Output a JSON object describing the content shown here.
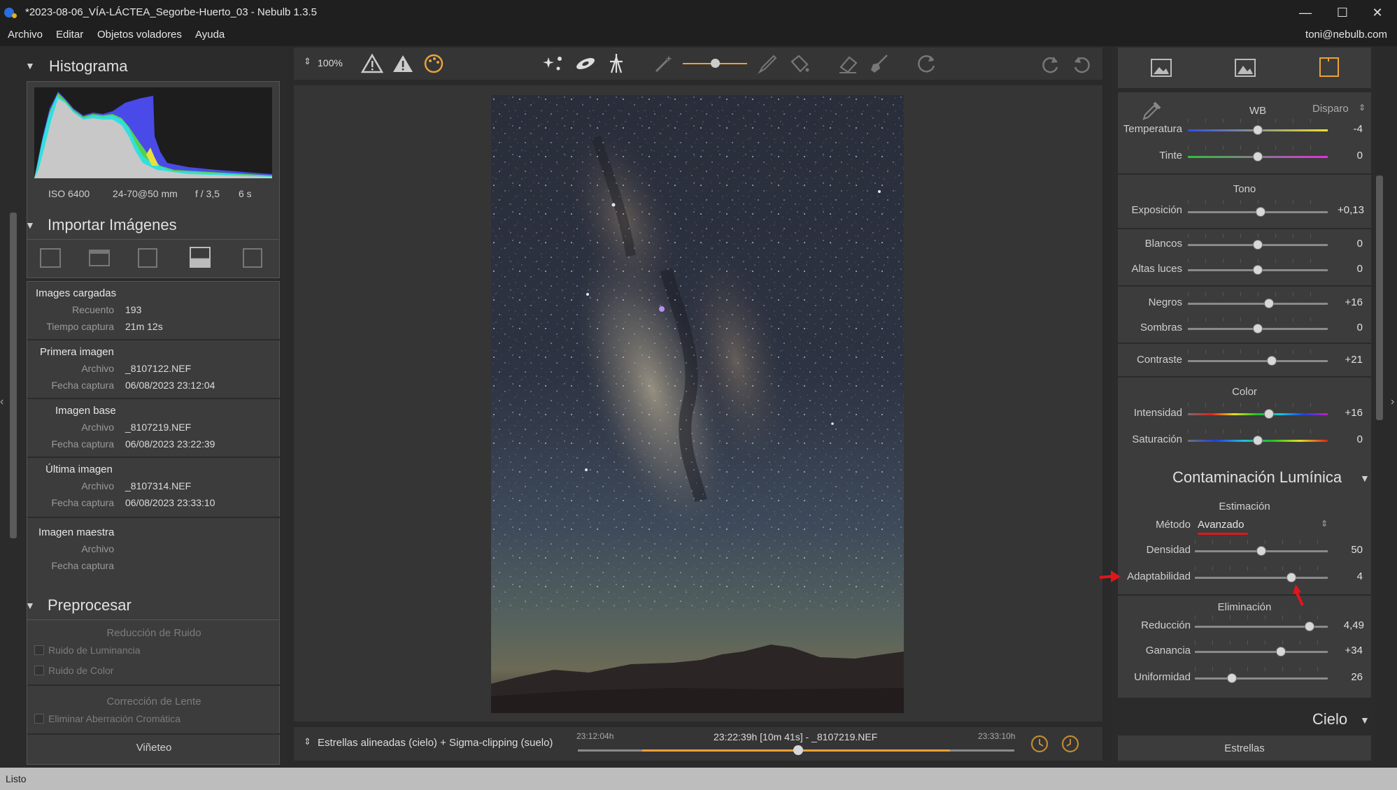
{
  "window": {
    "title": "*2023-08-06_VÍA-LÁCTEA_Segorbe-Huerto_03 - Nebulb 1.3.5",
    "min": "—",
    "max": "☐",
    "close": "✕"
  },
  "menu": {
    "items": [
      "Archivo",
      "Editar",
      "Objetos voladores",
      "Ayuda"
    ],
    "user": "toni@nebulb.com"
  },
  "histogram": {
    "title": "Histograma",
    "iso": "ISO 6400",
    "lens": "24-70@50 mm",
    "aperture": "f / 3,5",
    "exposure": "6 s"
  },
  "import": {
    "title": "Importar Imágenes",
    "loaded": {
      "header": "Images cargadas",
      "count_label": "Recuento",
      "count": "193",
      "time_label": "Tiempo captura",
      "time": "21m 12s"
    },
    "first": {
      "header": "Primera imagen",
      "file_label": "Archivo",
      "file": "_8107122.NEF",
      "date_label": "Fecha captura",
      "date": "06/08/2023 23:12:04"
    },
    "base": {
      "header": "Imagen base",
      "file_label": "Archivo",
      "file": "_8107219.NEF",
      "date_label": "Fecha captura",
      "date": "06/08/2023 23:22:39"
    },
    "last": {
      "header": "Última imagen",
      "file_label": "Archivo",
      "file": "_8107314.NEF",
      "date_label": "Fecha captura",
      "date": "06/08/2023 23:33:10"
    },
    "master": {
      "header": "Imagen maestra",
      "file_label": "Archivo",
      "date_label": "Fecha captura"
    }
  },
  "preprocess": {
    "title": "Preprocesar",
    "noise_header": "Reducción de Ruido",
    "noise_lum": "Ruido de Luminancia",
    "noise_color": "Ruido de Color",
    "lens_header": "Corrección de Lente",
    "chromatic": "Eliminar Aberración Cromática",
    "vignette": "Viñeteo"
  },
  "toolbar": {
    "zoom": "100%"
  },
  "timeline": {
    "mode": "Estrellas alineadas (cielo) + Sigma-clipping (suelo)",
    "start": "23:12:04h",
    "current": "23:22:39h [10m 41s] - _8107219.NEF",
    "end": "23:33:10h",
    "position": 0.5
  },
  "adjust": {
    "wb_label": "WB",
    "wb_mode": "Disparo",
    "sliders_wb": [
      {
        "label": "Temperatura",
        "value": "-4",
        "pos": 0.5
      },
      {
        "label": "Tinte",
        "value": "0",
        "pos": 0.5
      }
    ],
    "tone_header": "Tono",
    "sliders_tone": [
      {
        "label": "Exposición",
        "value": "+0,13",
        "pos": 0.52
      },
      {
        "label": "Blancos",
        "value": "0",
        "pos": 0.5
      },
      {
        "label": "Altas luces",
        "value": "0",
        "pos": 0.5
      },
      {
        "label": "Negros",
        "value": "+16",
        "pos": 0.58
      },
      {
        "label": "Sombras",
        "value": "0",
        "pos": 0.5
      },
      {
        "label": "Contraste",
        "value": "+21",
        "pos": 0.6
      }
    ],
    "color_header": "Color",
    "sliders_color": [
      {
        "label": "Intensidad",
        "value": "+16",
        "pos": 0.58
      },
      {
        "label": "Saturación",
        "value": "0",
        "pos": 0.5
      }
    ]
  },
  "lightpollution": {
    "title": "Contaminación Lumínica",
    "estimation_header": "Estimación",
    "method_label": "Método",
    "method_value": "Avanzado",
    "sliders_est": [
      {
        "label": "Densidad",
        "value": "50",
        "pos": 0.5
      },
      {
        "label": "Adaptabilidad",
        "value": "4",
        "pos": 0.73
      }
    ],
    "elimination_header": "Eliminación",
    "sliders_elim": [
      {
        "label": "Reducción",
        "value": "4,49",
        "pos": 0.87
      },
      {
        "label": "Ganancia",
        "value": "+34",
        "pos": 0.65
      },
      {
        "label": "Uniformidad",
        "value": "26",
        "pos": 0.28
      }
    ]
  },
  "sky": {
    "title": "Cielo",
    "stars": "Estrellas"
  },
  "status": {
    "text": "Listo"
  },
  "colors": {
    "accent": "#e8a23a",
    "annotation": "#e0161c"
  }
}
